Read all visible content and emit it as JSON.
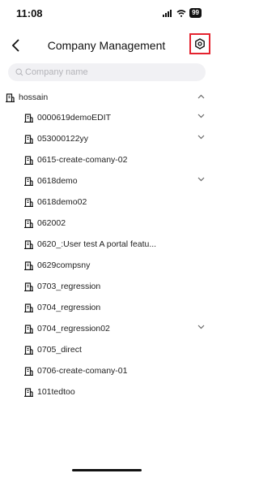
{
  "status_bar": {
    "time": "11:08",
    "battery": "99"
  },
  "nav": {
    "title": "Company Management"
  },
  "search": {
    "placeholder": "Company name",
    "value": ""
  },
  "tree": {
    "root": {
      "label": "hossain",
      "expanded": true
    },
    "children": [
      {
        "label": "0000619demoEDIT",
        "expandable": true
      },
      {
        "label": "053000122yy",
        "expandable": true
      },
      {
        "label": "0615-create-comany-02",
        "expandable": false
      },
      {
        "label": "0618demo",
        "expandable": true
      },
      {
        "label": "0618demo02",
        "expandable": false
      },
      {
        "label": "062002",
        "expandable": false
      },
      {
        "label": "0620_:User test A portal featu...",
        "expandable": false
      },
      {
        "label": "0629compsny",
        "expandable": false
      },
      {
        "label": "0703_regression",
        "expandable": false
      },
      {
        "label": "0704_regression",
        "expandable": false
      },
      {
        "label": "0704_regression02",
        "expandable": true
      },
      {
        "label": "0705_direct",
        "expandable": false
      },
      {
        "label": "0706-create-comany-01",
        "expandable": false
      },
      {
        "label": "101tedtoo",
        "expandable": false
      }
    ]
  },
  "icons": {
    "back": "chevron-left-icon",
    "settings": "hexagon-settings-icon",
    "search": "search-icon",
    "building": "building-icon",
    "expand": "chevron-down-icon",
    "collapse": "chevron-up-icon"
  },
  "colors": {
    "highlight": "#e4232f",
    "search_bg": "#f1f1f4",
    "text": "#222222"
  }
}
